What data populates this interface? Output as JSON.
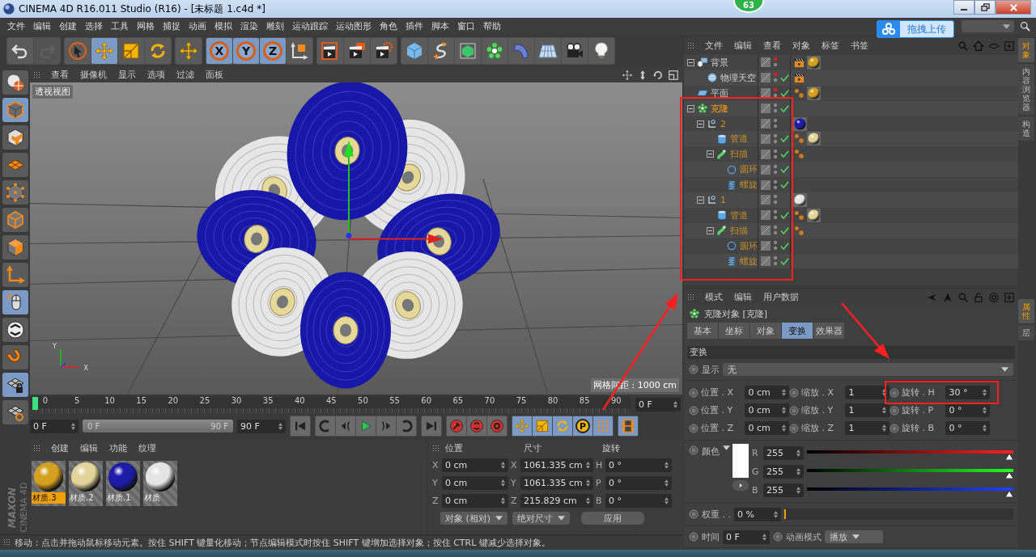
{
  "window": {
    "title": "CINEMA 4D R16.011 Studio (R16) - [未标题 1.c4d *]",
    "badge": "63"
  },
  "menu": [
    "文件",
    "编辑",
    "创建",
    "选择",
    "工具",
    "网格",
    "捕捉",
    "动画",
    "模拟",
    "渲染",
    "雕刻",
    "运动跟踪",
    "运动图形",
    "角色",
    "插件",
    "脚本",
    "窗口",
    "帮助"
  ],
  "upload_button": "拖拽上传",
  "toolbar": [
    [
      {
        "kind": "undo",
        "on": false,
        "disabled": false
      },
      {
        "kind": "redo",
        "on": false,
        "disabled": true
      }
    ],
    [
      {
        "kind": "select",
        "on": false,
        "disabled": false
      },
      {
        "kind": "move",
        "on": true,
        "disabled": false
      },
      {
        "kind": "scale",
        "on": false,
        "disabled": false
      },
      {
        "kind": "rotate",
        "on": false,
        "disabled": false
      }
    ],
    [
      {
        "kind": "move",
        "on": false,
        "disabled": false
      }
    ],
    [
      {
        "kind": "axis",
        "label": "X",
        "on": true,
        "disabled": false
      },
      {
        "kind": "axis",
        "label": "Y",
        "on": true,
        "disabled": false
      },
      {
        "kind": "axis",
        "label": "Z",
        "on": true,
        "disabled": false
      },
      {
        "kind": "coord",
        "on": false,
        "disabled": false
      }
    ],
    [
      {
        "kind": "render-view",
        "on": false,
        "disabled": false
      },
      {
        "kind": "render-pv",
        "on": false,
        "disabled": false
      },
      {
        "kind": "render-settings",
        "on": false,
        "disabled": false
      }
    ],
    [
      {
        "kind": "cube",
        "on": false,
        "disabled": false
      },
      {
        "kind": "spline",
        "on": false,
        "disabled": false
      },
      {
        "kind": "subdiv",
        "on": false,
        "disabled": false
      },
      {
        "kind": "cloner",
        "on": false,
        "disabled": false
      },
      {
        "kind": "bend",
        "on": false,
        "disabled": false
      },
      {
        "kind": "floor",
        "on": false,
        "disabled": false
      },
      {
        "kind": "camera",
        "on": false,
        "disabled": false
      },
      {
        "kind": "light",
        "on": false,
        "disabled": false
      }
    ]
  ],
  "left_tools": [
    {
      "kind": "globe",
      "on": false
    },
    {
      "kind": "model",
      "on": true
    },
    {
      "kind": "texture",
      "on": false
    },
    {
      "kind": "workplane",
      "on": false
    },
    {
      "kind": "points",
      "on": false
    },
    {
      "kind": "edges",
      "on": false
    },
    {
      "kind": "polys",
      "on": false
    },
    {
      "kind": "axis-tool",
      "on": false
    },
    {
      "kind": "mouse",
      "on": true
    },
    {
      "kind": "snap",
      "on": false
    },
    {
      "kind": "magnet",
      "on": false
    },
    {
      "kind": "grid-lock",
      "on": true
    },
    {
      "kind": "grid-rotate",
      "on": false
    }
  ],
  "logo": [
    "MAXON",
    "CINEMA 4D"
  ],
  "viewport": {
    "menu": [
      "查看",
      "摄像机",
      "显示",
      "选项",
      "过滤",
      "面板"
    ],
    "view_label": "透视视图",
    "grid_info": "网格间距 : 1000 cm",
    "axis_labels": [
      "Y",
      "X"
    ]
  },
  "timeline": {
    "ticks": [
      "0",
      "5",
      "10",
      "15",
      "20",
      "25",
      "30",
      "35",
      "40",
      "45",
      "50",
      "55",
      "60",
      "65",
      "70",
      "75",
      "80",
      "85",
      "90"
    ],
    "frame": "0 F",
    "start": "0 F",
    "range": {
      "start": "0 F",
      "end": "90 F",
      "level": 1
    },
    "end": "90 F"
  },
  "transport": [
    [
      {
        "kind": "first",
        "on": false
      }
    ],
    [
      {
        "kind": "prev-key",
        "on": false
      },
      {
        "kind": "prev-frame",
        "on": false
      },
      {
        "kind": "play",
        "on": false
      },
      {
        "kind": "next-frame",
        "on": false
      },
      {
        "kind": "next-key",
        "on": false
      }
    ],
    [
      {
        "kind": "last",
        "on": false
      }
    ],
    [
      {
        "kind": "record",
        "on": false
      },
      {
        "kind": "autokey",
        "on": false
      },
      {
        "kind": "keyhelp",
        "on": false
      }
    ],
    [
      {
        "kind": "move",
        "on": true
      },
      {
        "kind": "scale",
        "on": true
      },
      {
        "kind": "rotate",
        "on": true
      },
      {
        "kind": "param",
        "label": "P",
        "on": true
      },
      {
        "kind": "dots",
        "on": true
      }
    ],
    [
      {
        "kind": "film",
        "on": true
      }
    ]
  ],
  "materials": {
    "menu": [
      "创建",
      "编辑",
      "功能",
      "纹理"
    ],
    "items": [
      {
        "name": "材质.3",
        "color": "#d4a020",
        "selected": true
      },
      {
        "name": "材质.2",
        "color": "#e2d49a",
        "selected": false
      },
      {
        "name": "材质.1",
        "color": "#1c1ca8",
        "selected": false
      },
      {
        "name": "材质",
        "color": "#e4e4e4",
        "selected": false
      }
    ]
  },
  "coordinates": {
    "headers": [
      "位置",
      "尺寸",
      "旋转"
    ],
    "rows": [
      {
        "axis": "X",
        "position": "0 cm",
        "size_axis": "X",
        "size": "1061.335 cm",
        "rotation_axis": "H",
        "rotation": "0 °"
      },
      {
        "axis": "Y",
        "position": "0 cm",
        "size_axis": "Y",
        "size": "1061.335 cm",
        "rotation_axis": "P",
        "rotation": "0 °"
      },
      {
        "axis": "Z",
        "position": "0 cm",
        "size_axis": "Z",
        "size": "215.829 cm",
        "rotation_axis": "B",
        "rotation": "0 °"
      }
    ],
    "mode": "对象 (相对)",
    "size_mode": "绝对尺寸",
    "apply": "应用"
  },
  "status": "移动：点击并拖动鼠标移动元素。按住 SHIFT 键量化移动；节点编辑模式时按住 SHIFT 键增加选择对象；按住 CTRL 键减少选择对象。",
  "objects": {
    "menu": [
      "文件",
      "编辑",
      "查看",
      "对象",
      "标签",
      "书签"
    ],
    "tree": [
      {
        "name": "背景",
        "kind": "background",
        "selected": false,
        "editor_hidden": true,
        "enabled": false,
        "expanded": true,
        "tags": [
          {
            "kind": "compositing"
          },
          {
            "kind": "material",
            "color": "#d4a020"
          }
        ],
        "children": [
          {
            "name": "物理天空",
            "kind": "sky",
            "selected": false,
            "editor_hidden": true,
            "enabled": true,
            "tags": [
              {
                "kind": "compositing"
              }
            ]
          }
        ]
      },
      {
        "name": "平面",
        "kind": "plane",
        "selected": false,
        "editor_hidden": true,
        "enabled": true,
        "tags": [
          {
            "kind": "phong"
          },
          {
            "kind": "material",
            "color": "#d4a020"
          }
        ]
      },
      {
        "name": "克隆",
        "kind": "cloner",
        "selected": true,
        "editor_hidden": false,
        "enabled": true,
        "expanded": true,
        "children": [
          {
            "name": "2",
            "kind": "null",
            "selected": false,
            "editor_hidden": false,
            "enabled": false,
            "expanded": true,
            "tags": [
              {
                "kind": "material",
                "color": "#1c1ca8"
              }
            ],
            "children": [
              {
                "name": "管道",
                "kind": "tube",
                "selected": false,
                "editor_hidden": false,
                "enabled": true,
                "tags": [
                  {
                    "kind": "phong"
                  },
                  {
                    "kind": "material",
                    "color": "#e2d49a"
                  }
                ]
              },
              {
                "name": "扫描",
                "kind": "sweep",
                "selected": false,
                "editor_hidden": false,
                "enabled": true,
                "expanded": true,
                "tags": [
                  {
                    "kind": "phong"
                  }
                ],
                "children": [
                  {
                    "name": "圆环",
                    "kind": "circle",
                    "selected": false,
                    "editor_hidden": false,
                    "enabled": true
                  },
                  {
                    "name": "螺旋",
                    "kind": "helix",
                    "selected": false,
                    "editor_hidden": false,
                    "enabled": true
                  }
                ]
              }
            ]
          },
          {
            "name": "1",
            "kind": "null",
            "selected": false,
            "editor_hidden": false,
            "enabled": false,
            "expanded": true,
            "tags": [
              {
                "kind": "material",
                "color": "#e4e4e4"
              }
            ],
            "children": [
              {
                "name": "管道",
                "kind": "tube",
                "selected": false,
                "editor_hidden": false,
                "enabled": true,
                "tags": [
                  {
                    "kind": "phong"
                  },
                  {
                    "kind": "material",
                    "color": "#e2d49a"
                  }
                ]
              },
              {
                "name": "扫描",
                "kind": "sweep",
                "selected": false,
                "editor_hidden": false,
                "enabled": true,
                "expanded": true,
                "tags": [
                  {
                    "kind": "phong"
                  }
                ],
                "children": [
                  {
                    "name": "圆环",
                    "kind": "circle",
                    "selected": false,
                    "editor_hidden": false,
                    "enabled": true
                  },
                  {
                    "name": "螺旋",
                    "kind": "helix",
                    "selected": false,
                    "editor_hidden": false,
                    "enabled": true
                  }
                ]
              }
            ]
          }
        ]
      }
    ]
  },
  "attributes": {
    "menu": [
      "模式",
      "编辑",
      "用户数据"
    ],
    "title": "克隆对象 [克隆]",
    "tabs": [
      {
        "label": "基本",
        "selected": false
      },
      {
        "label": "坐标",
        "selected": false
      },
      {
        "label": "对象",
        "selected": false
      },
      {
        "label": "变换",
        "selected": true
      },
      {
        "label": "效果器",
        "selected": false
      }
    ],
    "section": "变换",
    "display": {
      "label": "显示",
      "value": "无"
    },
    "params": [
      {
        "label": "位置 . X",
        "value": "0 cm"
      },
      {
        "label": "缩放 . X",
        "value": "1"
      },
      {
        "label": "旋转 . H",
        "value": "30 °"
      },
      {
        "label": "位置 . Y",
        "value": "0 cm"
      },
      {
        "label": "缩放 . Y",
        "value": "1"
      },
      {
        "label": "旋转 . P",
        "value": "0 °"
      },
      {
        "label": "位置 . Z",
        "value": "0 cm"
      },
      {
        "label": "缩放 . Z",
        "value": "1"
      },
      {
        "label": "旋转 . B",
        "value": "0 °"
      }
    ],
    "color": {
      "label": "颜色",
      "channels": [
        {
          "label": "R",
          "value": "255",
          "level": 1
        },
        {
          "label": "G",
          "value": "255",
          "level": 1
        },
        {
          "label": "B",
          "value": "255",
          "level": 1
        }
      ]
    },
    "weight": {
      "label": "权重 . .",
      "value": "0 %",
      "level": 0
    },
    "time": {
      "label": "时间",
      "value": "0 F"
    },
    "anim_mode": {
      "label": "动画模式",
      "value": "播放"
    }
  },
  "side_tabs": [
    {
      "label": "对象",
      "selected": true
    },
    {
      "label": "内容浏览器",
      "selected": false
    },
    {
      "label": "构造",
      "selected": false
    }
  ],
  "side_tabs_lower": [
    {
      "label": "属性",
      "selected": true
    },
    {
      "label": "层",
      "selected": false
    }
  ]
}
